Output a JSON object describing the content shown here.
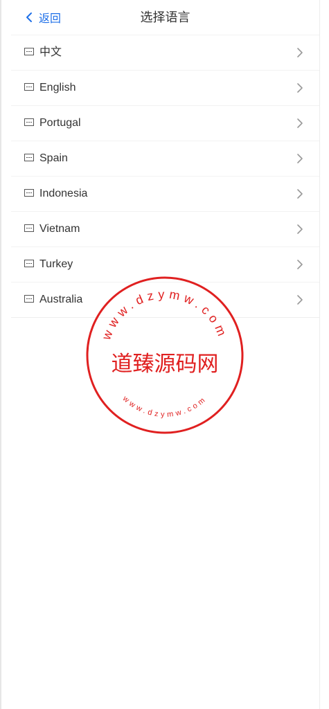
{
  "header": {
    "back_label": "返回",
    "title": "选择语言"
  },
  "languages": [
    {
      "label": "中文"
    },
    {
      "label": "English"
    },
    {
      "label": "Portugal"
    },
    {
      "label": "Spain"
    },
    {
      "label": "Indonesia"
    },
    {
      "label": "Vietnam"
    },
    {
      "label": "Turkey"
    },
    {
      "label": "Australia"
    }
  ],
  "watermark": {
    "center_text": "道臻源码网",
    "ring_text": "www.dzymw.com",
    "color": "#e02020"
  },
  "colors": {
    "accent": "#1e6fe8",
    "text": "#333333",
    "chevron": "#999999"
  }
}
